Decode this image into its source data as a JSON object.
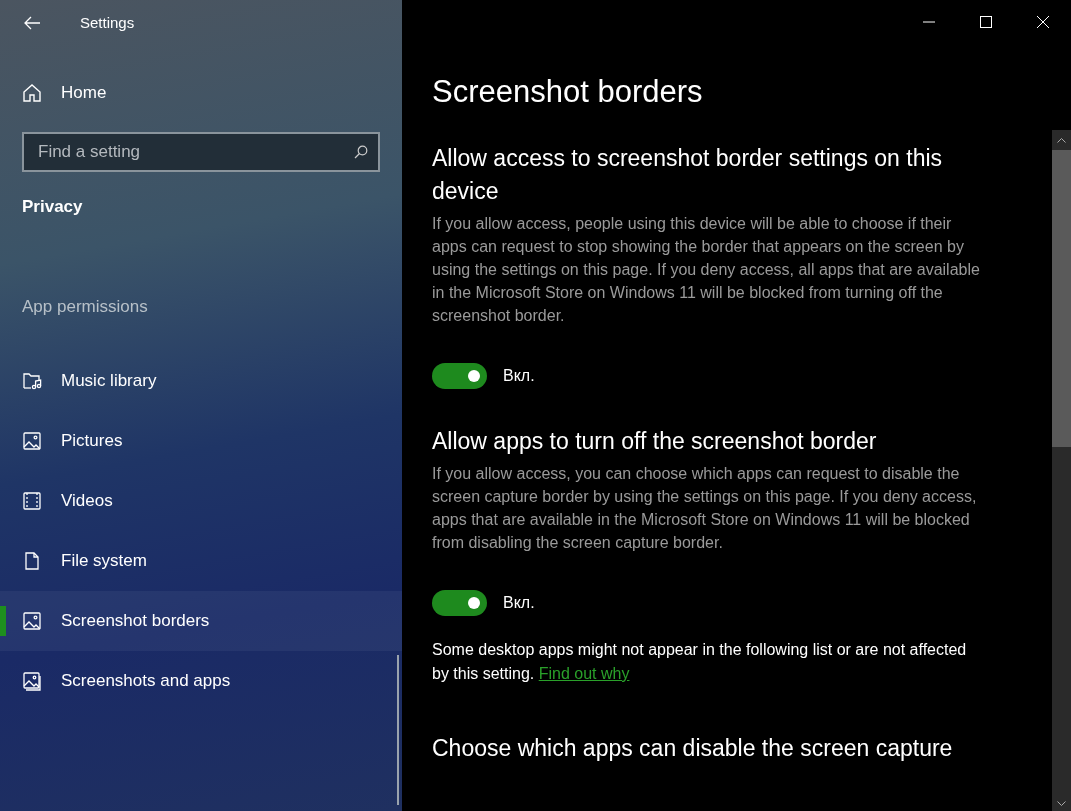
{
  "window": {
    "title": "Settings"
  },
  "sidebar": {
    "home": "Home",
    "search": {
      "placeholder": "Find a setting"
    },
    "category": "Privacy",
    "group": "App permissions",
    "items": [
      {
        "label": "Music library",
        "kind": "music",
        "selected": false
      },
      {
        "label": "Pictures",
        "kind": "picture",
        "selected": false
      },
      {
        "label": "Videos",
        "kind": "video",
        "selected": false
      },
      {
        "label": "File system",
        "kind": "file",
        "selected": false
      },
      {
        "label": "Screenshot borders",
        "kind": "picture",
        "selected": true
      },
      {
        "label": "Screenshots and apps",
        "kind": "pictures",
        "selected": false
      }
    ]
  },
  "page": {
    "title": "Screenshot borders",
    "sections": [
      {
        "heading": "Allow access to screenshot border settings on this device",
        "description": "If you allow access, people using this device will be able to choose if their apps can request to stop showing the border that appears on the screen by using the settings on this page. If you deny access, all apps that are available in the Microsoft Store on Windows 11 will be blocked from turning off the screenshot border.",
        "toggle": {
          "on": true,
          "label": "Вкл."
        }
      },
      {
        "heading": "Allow apps to turn off the screenshot border",
        "description": "If you allow access, you can choose which apps can request to disable the screen capture border by using the settings on this page. If you deny access, apps that are available in the Microsoft Store on Windows 11 will be blocked from disabling the screen capture border.",
        "toggle": {
          "on": true,
          "label": "Вкл."
        },
        "note": "Some desktop apps might not appear in the following list or are not affected by this setting.",
        "link": "Find out why"
      },
      {
        "heading": "Choose which apps can disable the screen capture"
      }
    ]
  }
}
